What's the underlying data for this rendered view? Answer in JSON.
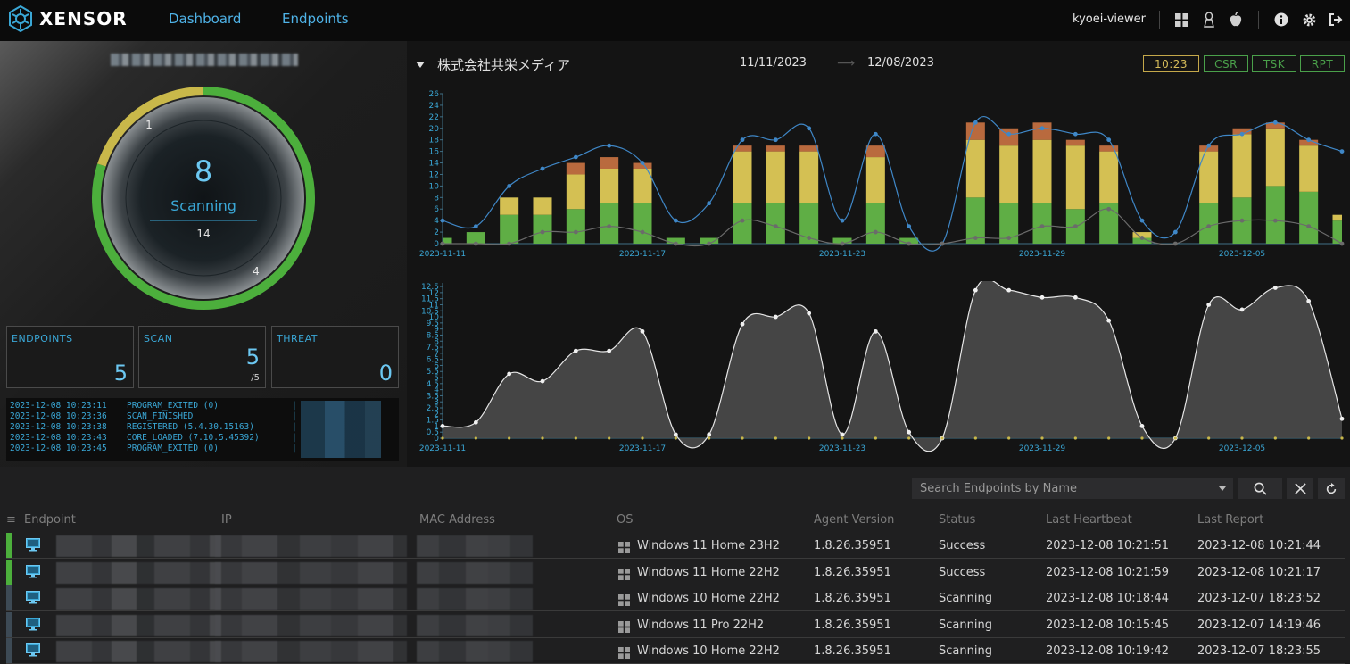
{
  "app": {
    "brand": "XENSOR",
    "user": "kyoei-viewer"
  },
  "nav": [
    {
      "label": "Dashboard"
    },
    {
      "label": "Endpoints"
    }
  ],
  "gauge": {
    "count": "8",
    "status": "Scanning",
    "total": "14",
    "label_a": "1",
    "label_b": "4",
    "colors": {
      "green": "#4caf3c",
      "yellow": "#c9b84a",
      "ring_dark": "#2a2a2a"
    }
  },
  "stats": [
    {
      "label": "ENDPOINTS",
      "value": "5",
      "sub": ""
    },
    {
      "label": "SCAN",
      "value": "5",
      "sub": "/5"
    },
    {
      "label": "THREAT",
      "value": "0",
      "sub": ""
    }
  ],
  "log": [
    {
      "time": "2023-12-08 10:23:11",
      "msg": "PROGRAM_EXITED (0)"
    },
    {
      "time": "2023-12-08 10:23:36",
      "msg": "SCAN_FINISHED"
    },
    {
      "time": "2023-12-08 10:23:38",
      "msg": "REGISTERED (5.4.30.15163)"
    },
    {
      "time": "2023-12-08 10:23:43",
      "msg": "CORE_LOADED (7.10.5.45392)"
    },
    {
      "time": "2023-12-08 10:23:45",
      "msg": "PROGRAM_EXITED (0)"
    }
  ],
  "header": {
    "company": "株式会社共栄メディア",
    "date_from": "11/11/2023",
    "date_to": "12/08/2023",
    "arrow": "⟶"
  },
  "tags": [
    {
      "label": "10:23",
      "active": true
    },
    {
      "label": "CSR"
    },
    {
      "label": "TSK"
    },
    {
      "label": "RPT"
    }
  ],
  "chart_data": [
    {
      "type": "bar",
      "stacked": true,
      "categories": [
        "2023-11-11",
        "2023-11-12",
        "2023-11-13",
        "2023-11-14",
        "2023-11-15",
        "2023-11-16",
        "2023-11-17",
        "2023-11-18",
        "2023-11-19",
        "2023-11-20",
        "2023-11-21",
        "2023-11-22",
        "2023-11-23",
        "2023-11-24",
        "2023-11-25",
        "2023-11-26",
        "2023-11-27",
        "2023-11-28",
        "2023-11-29",
        "2023-11-30",
        "2023-12-01",
        "2023-12-02",
        "2023-12-03",
        "2023-12-04",
        "2023-12-05",
        "2023-12-06",
        "2023-12-07",
        "2023-12-08"
      ],
      "x_tick_labels": [
        "2023-11-11",
        "2023-11-17",
        "2023-11-23",
        "2023-11-29",
        "2023-12-05"
      ],
      "x_tick_index": [
        0,
        6,
        12,
        18,
        24
      ],
      "ylim": [
        0,
        26
      ],
      "yticks": [
        0,
        2,
        4,
        6,
        8,
        10,
        12,
        14,
        16,
        18,
        20,
        22,
        24,
        26
      ],
      "series": [
        {
          "color": "#5fae45",
          "values": [
            1,
            2,
            5,
            5,
            6,
            7,
            7,
            1,
            1,
            7,
            7,
            7,
            1,
            7,
            1,
            0,
            8,
            7,
            7,
            6,
            7,
            1,
            0,
            7,
            8,
            10,
            9,
            4
          ]
        },
        {
          "color": "#d4c053",
          "values": [
            0,
            0,
            3,
            3,
            6,
            6,
            6,
            0,
            0,
            9,
            9,
            9,
            0,
            8,
            0,
            0,
            10,
            10,
            11,
            11,
            9,
            1,
            0,
            9,
            11,
            10,
            8,
            1
          ]
        },
        {
          "color": "#b96a3e",
          "values": [
            0,
            0,
            0,
            0,
            2,
            2,
            1,
            0,
            0,
            1,
            1,
            1,
            0,
            2,
            0,
            0,
            3,
            3,
            3,
            1,
            1,
            0,
            0,
            1,
            1,
            1,
            1,
            0
          ]
        }
      ],
      "lines": [
        {
          "color": "#3f87c7",
          "values": [
            4,
            3,
            10,
            13,
            15,
            17,
            14,
            4,
            7,
            18,
            18,
            20,
            4,
            19,
            3,
            0,
            21,
            19,
            20,
            19,
            18,
            4,
            2,
            17,
            19,
            21,
            18,
            16
          ]
        },
        {
          "color": "#6b6b6b",
          "values": [
            0,
            0,
            0,
            2,
            2,
            3,
            2,
            0,
            0,
            4,
            3,
            1,
            0,
            2,
            0,
            0,
            1,
            1,
            3,
            3,
            6,
            1,
            0,
            3,
            4,
            4,
            3,
            0
          ]
        }
      ]
    },
    {
      "type": "area",
      "categories": [
        "2023-11-11",
        "2023-11-12",
        "2023-11-13",
        "2023-11-14",
        "2023-11-15",
        "2023-11-16",
        "2023-11-17",
        "2023-11-18",
        "2023-11-19",
        "2023-11-20",
        "2023-11-21",
        "2023-11-22",
        "2023-11-23",
        "2023-11-24",
        "2023-11-25",
        "2023-11-26",
        "2023-11-27",
        "2023-11-28",
        "2023-11-29",
        "2023-11-30",
        "2023-12-01",
        "2023-12-02",
        "2023-12-03",
        "2023-12-04",
        "2023-12-05",
        "2023-12-06",
        "2023-12-07",
        "2023-12-08"
      ],
      "x_tick_labels": [
        "2023-11-11",
        "2023-11-17",
        "2023-11-23",
        "2023-11-29",
        "2023-12-05"
      ],
      "x_tick_index": [
        0,
        6,
        12,
        18,
        24
      ],
      "ylim": [
        0,
        12.8
      ],
      "yticks": [
        0,
        0.5,
        1,
        1.5,
        2,
        2.5,
        3,
        3.5,
        4,
        4.5,
        5,
        5.5,
        6,
        6.5,
        7,
        7.5,
        8,
        8.5,
        9,
        9.5,
        10,
        10.5,
        11,
        11.5,
        12,
        12.5
      ],
      "values": [
        1,
        1.3,
        5.3,
        4.7,
        7.2,
        7.2,
        8.8,
        0.3,
        0.3,
        9.4,
        10,
        10.3,
        0.3,
        8.8,
        0.5,
        0,
        12.2,
        12.2,
        11.6,
        11.6,
        9.7,
        1,
        0,
        11,
        10.6,
        12.4,
        11.3,
        1.6
      ],
      "fill": "#4a4a4a",
      "line": "#e6e6e6"
    }
  ],
  "search": {
    "placeholder": "Search Endpoints by Name"
  },
  "table": {
    "columns": [
      "Endpoint",
      "IP",
      "MAC Address",
      "OS",
      "Agent Version",
      "Status",
      "Last Heartbeat",
      "Last Report"
    ],
    "rows": [
      {
        "os": "Windows 11 Home 23H2",
        "agent": "1.8.26.35951",
        "status": "Success",
        "heartbeat": "2023-12-08 10:21:51",
        "report": "2023-12-08 10:21:44",
        "stripe": "#4caf3c"
      },
      {
        "os": "Windows 11 Home 22H2",
        "agent": "1.8.26.35951",
        "status": "Success",
        "heartbeat": "2023-12-08 10:21:59",
        "report": "2023-12-08 10:21:17",
        "stripe": "#4caf3c"
      },
      {
        "os": "Windows 10 Home 22H2",
        "agent": "1.8.26.35951",
        "status": "Scanning",
        "heartbeat": "2023-12-08 10:18:44",
        "report": "2023-12-07 18:23:52",
        "stripe": "#3d4a55"
      },
      {
        "os": "Windows 11 Pro 22H2",
        "agent": "1.8.26.35951",
        "status": "Scanning",
        "heartbeat": "2023-12-08 10:15:45",
        "report": "2023-12-07 14:19:46",
        "stripe": "#3d4a55"
      },
      {
        "os": "Windows 10 Home 22H2",
        "agent": "1.8.26.35951",
        "status": "Scanning",
        "heartbeat": "2023-12-08 10:19:42",
        "report": "2023-12-07 18:23:55",
        "stripe": "#3d4a55"
      }
    ]
  },
  "icons": {
    "windows": "windows-icon",
    "linux": "linux-icon",
    "apple": "apple-icon",
    "info": "info-icon",
    "gear": "gear-icon",
    "logout": "logout-icon"
  }
}
